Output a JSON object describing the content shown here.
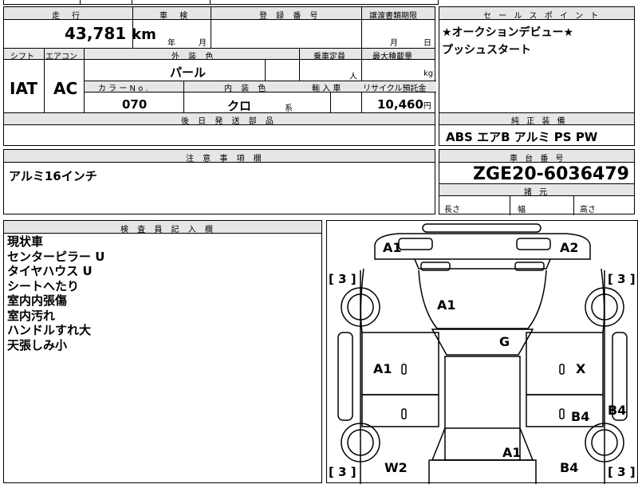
{
  "top_strip": {
    "partial_text": "…"
  },
  "vehicle": {
    "hdr_mileage": "走 行",
    "hdr_inspection": "車 検",
    "hdr_registration": "登 録 番 号",
    "hdr_transfer": "譲渡書類期限",
    "mileage_value": "43,781",
    "mileage_unit": "km",
    "year_label": "年",
    "month_label": "月",
    "transfer_month": "月",
    "transfer_day": "日",
    "hdr_shift": "シフト",
    "hdr_aircon": "エアコン",
    "hdr_exterior": "外 装 色",
    "hdr_capacity": "乗車定員",
    "hdr_maxload": "最大積載量",
    "shift_value": "IAT",
    "aircon_value": "AC",
    "exterior_value": "パール",
    "capacity_unit": "人",
    "maxload_unit": "kg",
    "hdr_color_no": "カ ラ ー N o .",
    "hdr_interior": "内 装 色",
    "hdr_import": "輸 入 車",
    "hdr_recycle": "リサイクル預託金",
    "color_no_value": "070",
    "interior_value": "クロ",
    "interior_suffix": "系",
    "recycle_value": "10,460",
    "recycle_unit": "円",
    "hdr_later_parts": "後 日 発 送 部 品"
  },
  "sales": {
    "header": "セ ー ル ス ポ イ ン ト",
    "line1": "★オークションデビュー★",
    "line2": "プッシュスタート"
  },
  "equipment": {
    "header": "純 正 装 備",
    "value": "ABS エアB アルミ PS PW"
  },
  "notes": {
    "header": "注 意 事 項 欄",
    "value": "アルミ16インチ"
  },
  "chassis": {
    "header": "車 台 番 号",
    "value": "ZGE20-6036479",
    "dims_header": "諸 元",
    "length": "長さ",
    "width": "幅",
    "height": "高さ"
  },
  "inspector": {
    "header": "検 査 員 記 入 欄",
    "lines": [
      "現状車",
      "センターピラー U",
      "タイヤハウス U",
      "シートへたり",
      "室内内張傷",
      "室内汚れ",
      "ハンドルすれ大",
      "天張しみ小"
    ]
  },
  "diagram": {
    "marks": {
      "a1_front_left": "A1",
      "a2_front_right": "A2",
      "a1_hood": "A1",
      "g_windshield": "G",
      "a1_left_door": "A1",
      "x_right_door": "X",
      "b4_right_rear_door": "B4",
      "b4_right_side": "B4",
      "a1_rear": "A1",
      "w2_rear_left": "W2",
      "b4_rear_right": "B4"
    },
    "tire_tl": "[ 3 ]",
    "tire_tr": "[ 3 ]",
    "tire_bl": "[ 3 ]",
    "tire_br": "[ 3 ]"
  }
}
